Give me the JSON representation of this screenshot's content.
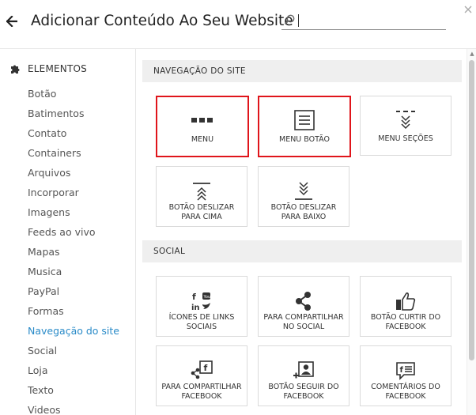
{
  "header": {
    "title": "Adicionar Conteúdo Ao Seu Website",
    "search_value": "",
    "back_glyph": "🡐",
    "close_glyph": "×"
  },
  "sidebar": {
    "heading": "ELEMENTOS",
    "items": [
      "Botão",
      "Batimentos",
      "Contato",
      "Containers",
      "Arquivos",
      "Incorporar",
      "Imagens",
      "Feeds ao vivo",
      "Mapas",
      "Musica",
      "PayPal",
      "Formas",
      "Navegação do site",
      "Social",
      "Loja",
      "Texto",
      "Videos"
    ],
    "active_item": "Navegação do site"
  },
  "sections": [
    {
      "title": "NAVEGAÇÃO DO SITE",
      "tiles": [
        {
          "label": "MENU",
          "icon": "menu-dots-icon",
          "highlighted": true
        },
        {
          "label": "MENU BOTÃO",
          "icon": "menu-list-icon",
          "highlighted": true
        },
        {
          "label": "MENU SEÇÕES",
          "icon": "menu-sections-icon",
          "highlighted": false
        },
        {
          "label": "BOTÃO DESLIZAR PARA CIMA",
          "icon": "scroll-up-icon",
          "highlighted": false
        },
        {
          "label": "BOTÃO DESLIZAR PARA BAIXO",
          "icon": "scroll-down-icon",
          "highlighted": false
        }
      ]
    },
    {
      "title": "SOCIAL",
      "tiles": [
        {
          "label": "ÍCONES DE LINKS SOCIAIS",
          "icon": "social-links-icon",
          "highlighted": false
        },
        {
          "label": "PARA COMPARTILHAR NO SOCIAL",
          "icon": "share-icon",
          "highlighted": false
        },
        {
          "label": "BOTÃO CURTIR DO FACEBOOK",
          "icon": "thumbs-up-icon",
          "highlighted": false
        },
        {
          "label": "PARA COMPARTILHAR FACEBOOK",
          "icon": "facebook-share-icon",
          "highlighted": false
        },
        {
          "label": "BOTÃO SEGUIR DO FACEBOOK",
          "icon": "facebook-follow-icon",
          "highlighted": false
        },
        {
          "label": "COMENTÁRIOS DO FACEBOOK",
          "icon": "facebook-comments-icon",
          "highlighted": false
        }
      ]
    }
  ],
  "colors": {
    "accent": "#2a8bc8",
    "highlight": "#e0151b",
    "section_bg": "#efefef"
  }
}
